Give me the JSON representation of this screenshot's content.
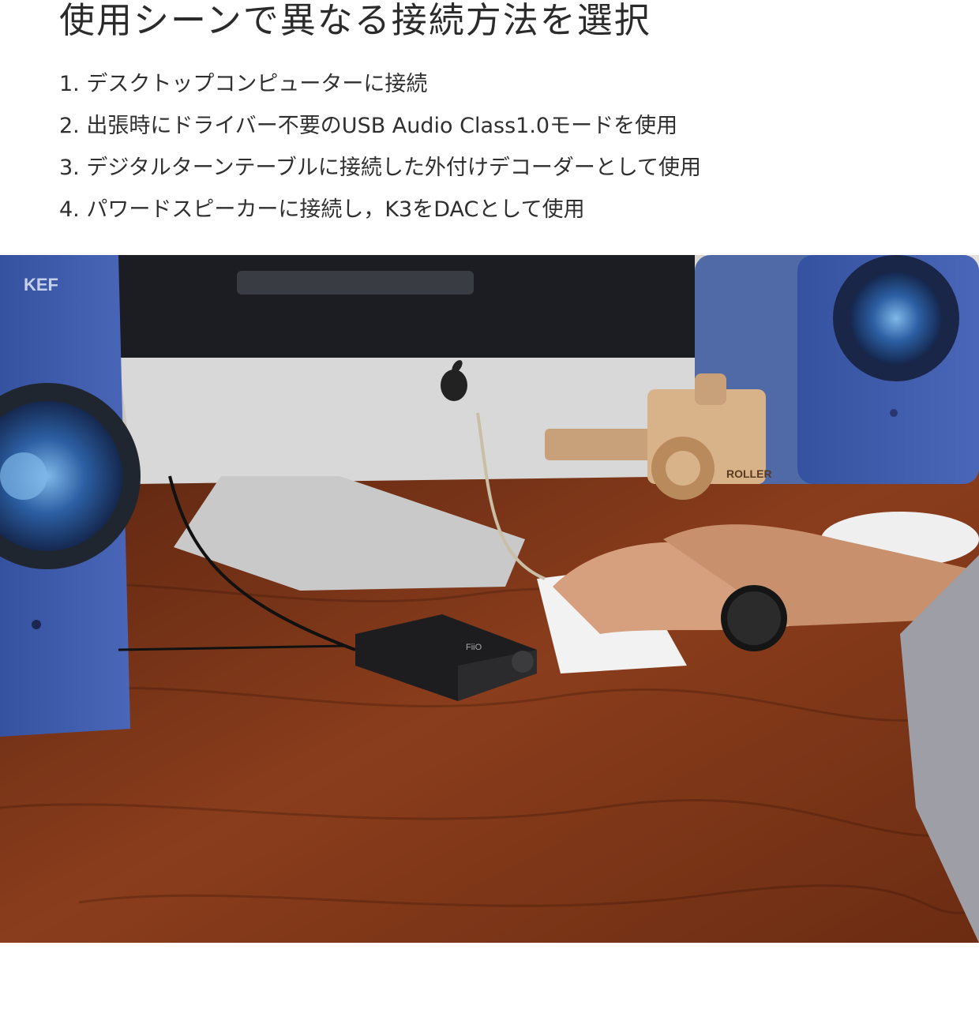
{
  "heading": "使用シーンで異なる接続方法を選択",
  "items": [
    "1. デスクトップコンピューターに接続",
    "2. 出張時にドライバー不要のUSB Audio Class1.0モードを使用",
    "3. デジタルターンテーブルに接続した外付けデコーダーとして使用",
    "4. パワードスピーカーに接続し，K3をDACとして使用"
  ],
  "photo": {
    "speaker_brand": "KEF",
    "toy_label": "ROLLER",
    "dac_label": "FiiO",
    "colors": {
      "desk": "#7a3419",
      "speaker": "#3e5aa8",
      "monitor": "#d9d9d9"
    }
  }
}
